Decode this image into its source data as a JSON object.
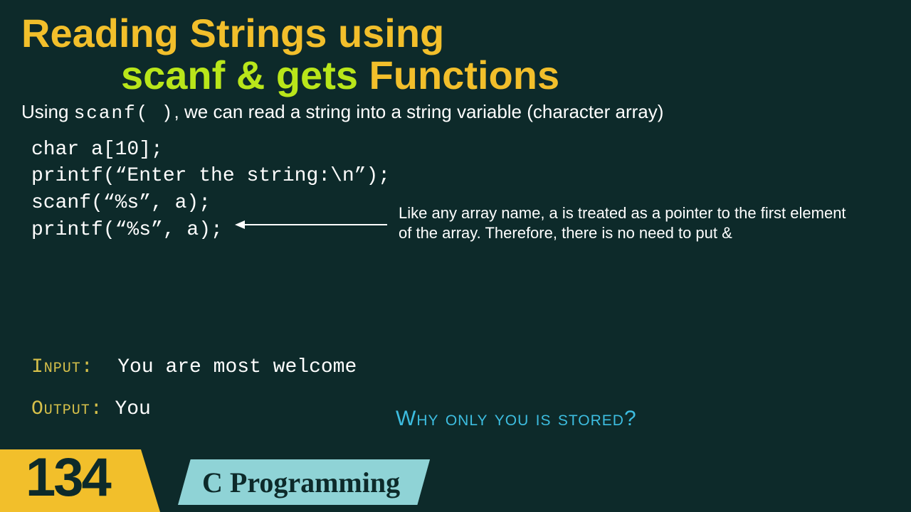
{
  "title": {
    "line1": "Reading Strings using",
    "line2_green": "scanf & gets",
    "line2_rest": " Functions"
  },
  "intro": {
    "pre": "Using ",
    "mono": "scanf( )",
    "post": ", we can read a string into a string variable (character array)"
  },
  "code": "char a[10];\nprintf(“Enter the string:\\n”);\nscanf(“%s”, a);\nprintf(“%s”, a);",
  "annotation": "Like any array name, a is treated as a pointer to the first element of the array. Therefore, there is no need to put &",
  "io": {
    "input_label": "Input:",
    "input_value": "You are most welcome",
    "output_label": "Output:",
    "output_value": "You"
  },
  "question": {
    "pre": "Why only ",
    "emph": "you",
    "post": " is stored?"
  },
  "badges": {
    "number": "134",
    "course": "C Programming"
  }
}
